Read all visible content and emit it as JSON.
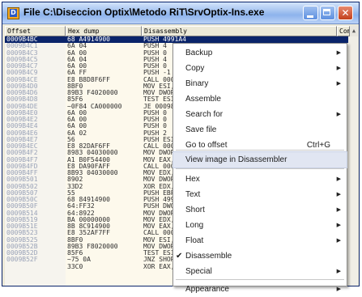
{
  "window": {
    "title": "File C:\\Diseccion Optix\\Metodo RiT\\SrvOptix-Ins.exe",
    "app_icon_letter": "D",
    "close_glyph": "✕"
  },
  "columns": {
    "offset": "Offset",
    "hex": "Hex dump",
    "disassembly": "Disassembly",
    "comment": "Com"
  },
  "listing": {
    "offsets": [
      "0009B4BC",
      "0009B4C1",
      "0009B4C3",
      "0009B4C5",
      "0009B4C7",
      "0009B4C9",
      "0009B4CE",
      "0009B4D0",
      "0009B4D6",
      "0009B4D8",
      "0009B4DE",
      "0009B4E0",
      "0009B4E2",
      "0009B4E4",
      "0009B4E6",
      "0009B4E7",
      "0009B4EC",
      "0009B4F2",
      "0009B4F7",
      "0009B4FD",
      "0009B4FF",
      "0009B501",
      "0009B502",
      "0009B507",
      "0009B50C",
      "0009B50F",
      "0009B514",
      "0009B519",
      "0009B51E",
      "0009B523",
      "0009B525",
      "0009B52B",
      "0009B52D",
      "0009B52F"
    ],
    "hex": [
      "68 A4914900",
      "6A 04",
      "6A 00",
      "6A 04",
      "6A 00",
      "6A FF",
      "E8 B8D8F6FF",
      "8BF0",
      "89B3 F4020000",
      "85F6",
      "~0F84 CA000000",
      "6A 00",
      "6A 00",
      "6A 00",
      "6A 02",
      "56",
      "E8 82DAF6FF",
      "8983 04030000",
      "A1 B0F54400",
      "E8 DA90FAFF",
      "8B93 04030000",
      "8902",
      "33D2",
      "55",
      "68 84914900",
      "64:FF32",
      "64:8922",
      "BA 00000000",
      "8B 8C914900",
      "E8 352AF7FF",
      "8BF0",
      "89B3 F8020000",
      "85F6",
      "~75 0A",
      "33C0"
    ],
    "disasm": [
      "PUSH 4991A4",
      "PUSH 4",
      "PUSH 0",
      "PUSH 4",
      "PUSH 0",
      "PUSH -1",
      "CALL 0009",
      "MOV ESI,",
      "MOV DWORD",
      "TEST ESI,",
      "JE 00098",
      "PUSH 0",
      "PUSH 0",
      "PUSH 0",
      "PUSH 2",
      "PUSH ESI",
      "CALL 0009",
      "MOV DWORD",
      "MOV EAX,",
      "CALL 0004",
      "MOV EDX,",
      "MOV DWORD",
      "XOR EDX,",
      "PUSH EBP",
      "PUSH 4991",
      "PUSH DWOR",
      "MOV DWORD",
      "MOV EDX,",
      "MOV EAX,",
      "CALL 0008",
      "MOV ESI,",
      "MOV DWORD",
      "TEST ESI,",
      "JNZ SHOR",
      "XOR EAX,EAX"
    ]
  },
  "context_menu": {
    "items": [
      {
        "label": "Backup",
        "submenu": true
      },
      {
        "label": "Copy",
        "submenu": true
      },
      {
        "label": "Binary",
        "submenu": true
      },
      {
        "label": "Assemble"
      },
      {
        "label": "Search for",
        "submenu": true
      },
      {
        "label": "Save file"
      },
      {
        "label": "Go to offset",
        "shortcut": "Ctrl+G"
      },
      {
        "label": "View image in Disassembler",
        "highlighted": true
      },
      {
        "label": "Hex",
        "submenu": true
      },
      {
        "label": "Text",
        "submenu": true
      },
      {
        "label": "Short",
        "submenu": true
      },
      {
        "label": "Long",
        "submenu": true
      },
      {
        "label": "Float",
        "submenu": true
      },
      {
        "label": "Disassemble",
        "checked": true
      },
      {
        "label": "Special",
        "submenu": true
      },
      {
        "label": "Appearance",
        "submenu": true
      }
    ],
    "submenu_glyph": "▶",
    "check_glyph": "✔"
  },
  "colors": {
    "selection": "#0a246a",
    "menu_highlight": "#e1e6f2",
    "title_gradient_mid": "#8db3ec"
  }
}
